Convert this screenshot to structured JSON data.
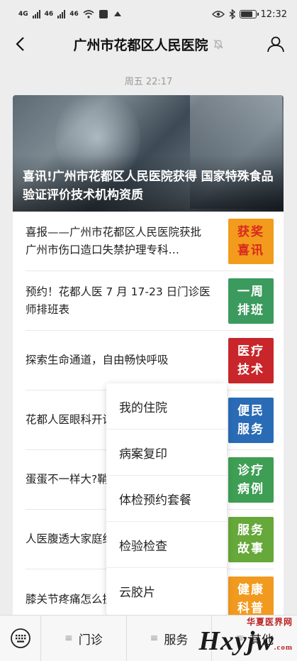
{
  "status_bar": {
    "left_labels": [
      "4G",
      "46",
      "46"
    ],
    "time": "12:32"
  },
  "header": {
    "title": "广州市花都区人民医院"
  },
  "timestamp": "周五 22:17",
  "hero": {
    "title": "喜讯!广州市花都区人民医院获得 国家特殊食品验证评价技术机构资质"
  },
  "articles": [
    {
      "title": "喜报——广州市花都区人民医院获批广州市伤口造口失禁护理专科…",
      "thumb_lines": [
        "获奖",
        "喜讯"
      ],
      "thumb_bg": "#f29b1c",
      "thumb_fg": "#d9281f"
    },
    {
      "title": "预约！花都人医 7 月 17-23 日门诊医师排班表",
      "thumb_lines": [
        "一周",
        "排班"
      ],
      "thumb_bg": "#3b9a5d",
      "thumb_fg": "#ffffff"
    },
    {
      "title": "探索生命通道，自由畅快呼吸",
      "thumb_lines": [
        "医疗",
        "技术"
      ],
      "thumb_bg": "#c8262a",
      "thumb_fg": "#ffffff"
    },
    {
      "title": "花都人医眼科开设绿色通道”啦！",
      "thumb_lines": [
        "便民",
        "服务"
      ],
      "thumb_bg": "#2a6bb6",
      "thumb_fg": "#ffffff"
    },
    {
      "title": "蛋蛋不一样大?鞘膜积液",
      "thumb_lines": [
        "诊疗",
        "病例"
      ],
      "thumb_bg": "#3e9e54",
      "thumb_fg": "#ffffff"
    },
    {
      "title": "人医腹透大家庭给力！必须点赞",
      "thumb_lines": [
        "服务",
        "故事"
      ],
      "thumb_bg": "#66a83a",
      "thumb_fg": "#ffffff"
    },
    {
      "title": "膝关节疼痛怎么操",
      "thumb_lines": [
        "健康",
        "科普"
      ],
      "thumb_bg": "#f19a1f",
      "thumb_fg": "#ffffff"
    }
  ],
  "menu": {
    "items": [
      "我的住院",
      "病案复印",
      "体检预约套餐",
      "检验检查",
      "云胶片"
    ]
  },
  "bottom_bar": {
    "tabs": [
      "门诊",
      "服务",
      "其他"
    ]
  },
  "watermark": {
    "cn": "华夏医界网",
    "en": "Hxyjw",
    "suffix": ".com"
  }
}
